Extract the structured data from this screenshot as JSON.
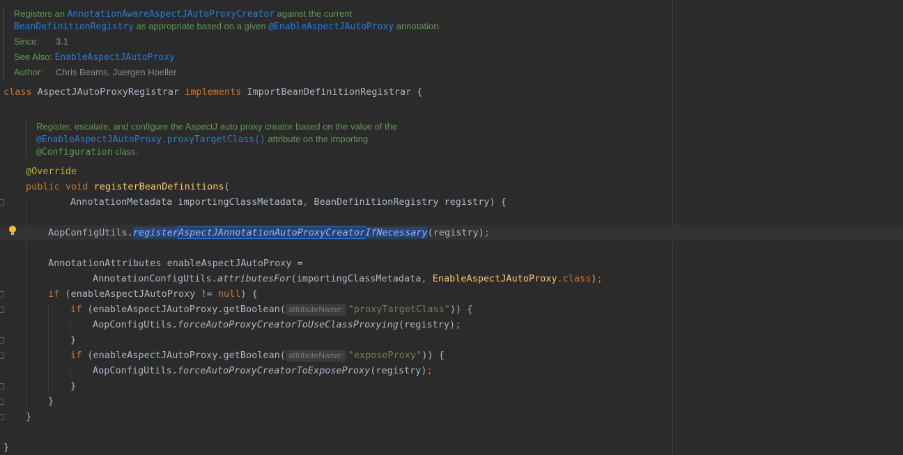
{
  "classdoc": {
    "t1a": "Registers an ",
    "t1b": "AnnotationAwareAspectJAutoProxyCreator",
    "t1c": " against the current",
    "t2a": "BeanDefinitionRegistry",
    "t2b": " as appropriate based on a given ",
    "t2c": "@EnableAspectJAutoProxy",
    "t2d": " annotation.",
    "since_label": "Since:",
    "since_value": "3.1",
    "see_label": "See Also:",
    "see_value": "EnableAspectJAutoProxy",
    "author_label": "Author:",
    "author_value": "Chris Beams, Juergen Hoeller"
  },
  "class_decl": {
    "kw_class": "class",
    "name": "AspectJAutoProxyRegistrar",
    "kw_implements": "implements",
    "iface": "ImportBeanDefinitionRegistrar",
    "brace": " {"
  },
  "methoddoc": {
    "l1": "Register, escalate, and configure the AspectJ auto proxy creator based on the value of the",
    "l2a": "@EnableAspectJAutoProxy.proxyTargetClass()",
    "l2b": " attribute on the importing",
    "l3a": "@Configuration",
    "l3b": " class."
  },
  "code": {
    "override": "@Override",
    "kw_public": "public",
    "kw_void": "void",
    "method": "registerBeanDefinitions",
    "paren_open": "(",
    "params_a": "AnnotationMetadata importingClassMetadata",
    "comma": ",",
    "params_b": " BeanDefinitionRegistry registry) {",
    "aop": "AopConfigUtils.",
    "call_a": "register",
    "call_b": "AspectJAnnotationAutoProxyCreator",
    "call_c": "IfNecessary",
    "call_args": "(registry)",
    "semi": ";",
    "attrs_decl": "AnnotationAttributes enableAspectJAutoProxy =",
    "acu": "AnnotationConfigUtils.",
    "attributes_for": "attributesFor",
    "af_args": "(importingClassMetadata",
    "af_class": "EnableAspectJAutoProxy",
    "dot_class": ".class",
    "close_paren": ")",
    "kw_if": "if",
    "if1_a": " (enableAspectJAutoProxy != ",
    "kw_null": "null",
    "if1_b": ") {",
    "if2_a": " (enableAspectJAutoProxy.getBoolean(",
    "hint": "attributeName:",
    "str_proxy": "\"proxyTargetClass\"",
    "if2_b": ")) {",
    "force_class": "forceAutoProxyCreatorToUseClassProxying",
    "force_expose": "forceAutoProxyCreatorToExposeProxy",
    "reg_args": "(registry)",
    "str_expose": "\"exposeProxy\"",
    "rbrace": "}"
  }
}
